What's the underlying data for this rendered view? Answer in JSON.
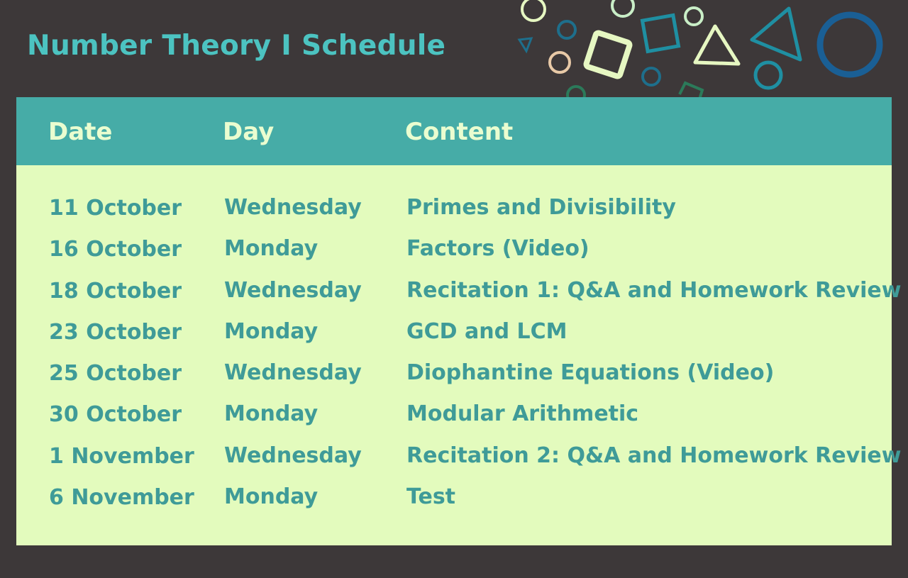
{
  "title": "Number Theory I Schedule",
  "colors": {
    "background": "#3d3839",
    "title": "#4cc3c1",
    "header_bg": "#46aca7",
    "header_text": "#eafdd0",
    "panel_bg": "#e3fbbd",
    "row_text": "#3f9b98"
  },
  "table": {
    "headers": [
      "Date",
      "Day",
      "Content"
    ],
    "rows": [
      {
        "date": "11 October",
        "day": "Wednesday",
        "content": "Primes and Divisibility"
      },
      {
        "date": "16 October",
        "day": "Monday",
        "content": "Factors (Video)"
      },
      {
        "date": "18 October",
        "day": "Wednesday",
        "content": "Recitation 1: Q&A and Homework Review"
      },
      {
        "date": "23 October",
        "day": "Monday",
        "content": "GCD and LCM"
      },
      {
        "date": "25 October",
        "day": "Wednesday",
        "content": "Diophantine Equations (Video)"
      },
      {
        "date": "30 October",
        "day": "Monday",
        "content": "Modular Arithmetic"
      },
      {
        "date": "1 November",
        "day": "Wednesday",
        "content": "Recitation 2: Q&A and Homework Review"
      },
      {
        "date": "6 November",
        "day": "Monday",
        "content": "Test"
      }
    ]
  }
}
